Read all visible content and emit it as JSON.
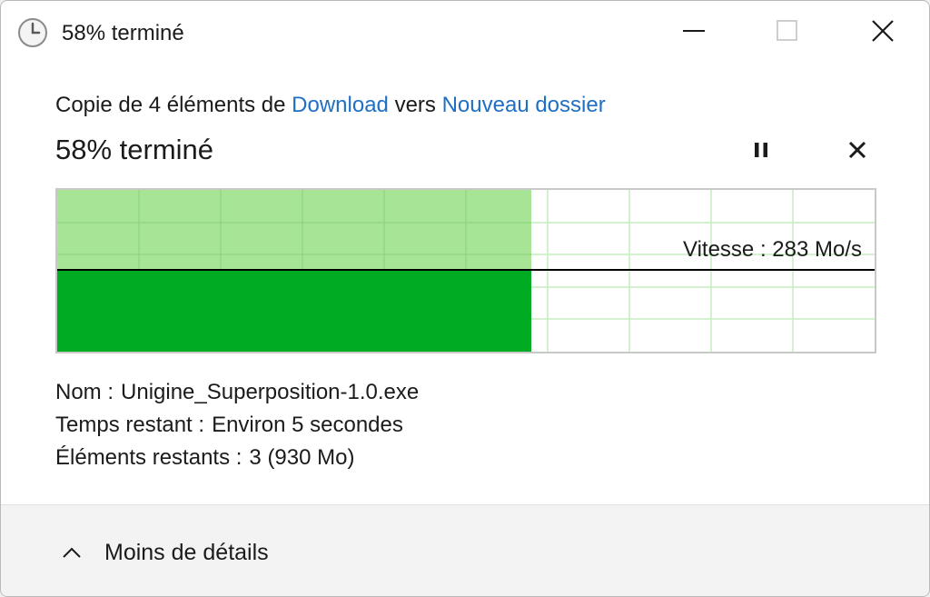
{
  "window": {
    "title": "58% terminé",
    "icons": {
      "app": "clock-icon",
      "minimize": "minimize-icon",
      "maximize": "maximize-icon",
      "close": "close-icon"
    }
  },
  "copy": {
    "prefix": "Copie de 4 éléments de ",
    "source": "Download",
    "middle": " vers ",
    "destination": "Nouveau dossier"
  },
  "progress": {
    "title": "58% terminé",
    "percent": 58,
    "speed_label": "Vitesse : 283 Mo/s",
    "speed_level": 0.5,
    "pause_icon": "pause-icon",
    "cancel_icon": "cancel-icon"
  },
  "details": {
    "name_label": "Nom :",
    "name_value": "Unigine_Superposition-1.0.exe",
    "time_label": "Temps restant :",
    "time_value": "Environ 5 secondes",
    "items_label": "Éléments restants :",
    "items_value": "3 (930 Mo)"
  },
  "footer": {
    "less_details_label": "Moins de détails",
    "chevron_icon": "chevron-up-icon"
  },
  "colors": {
    "fill_dark": "#00ab24",
    "fill_light": "#a8e496",
    "grid": "#c6eec0",
    "link": "#1f6fc5",
    "speed_line": "#000000"
  }
}
